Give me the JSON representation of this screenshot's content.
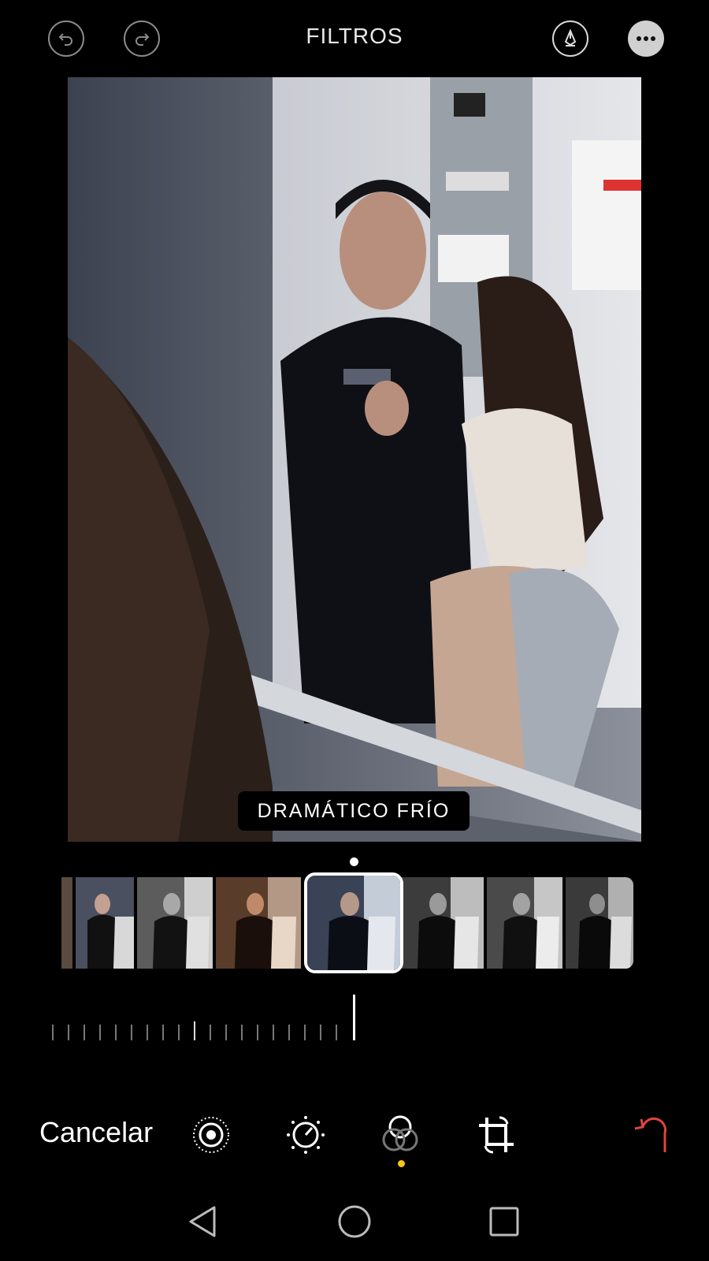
{
  "header": {
    "title": "FILTROS",
    "undo_icon": "undo-icon",
    "redo_icon": "redo-icon",
    "markup_icon": "pen-tip-icon",
    "more_icon": "ellipsis-icon"
  },
  "photo": {
    "filter_name": "DRAMÁTICO FRÍO",
    "floor_display": "2"
  },
  "filmstrip": {
    "selected_index": 4,
    "thumbnails": [
      {
        "filter": "warm"
      },
      {
        "filter": "vivid-cool"
      },
      {
        "filter": "dramatic"
      },
      {
        "filter": "dramatic-warm"
      },
      {
        "filter": "dramatic-cool"
      },
      {
        "filter": "mono"
      },
      {
        "filter": "silvertone"
      },
      {
        "filter": "noir"
      }
    ]
  },
  "toolbar": {
    "cancel_label": "Cancelar",
    "tools": [
      "live-photo-icon",
      "adjust-dial-icon",
      "filters-icon",
      "crop-rotate-icon"
    ],
    "active_tool": "filters-icon",
    "revert_icon": "revert-icon"
  },
  "system_nav": [
    "back-triangle-icon",
    "home-circle-icon",
    "recents-square-icon"
  ],
  "colors": {
    "background": "#000000",
    "accent_yellow": "#f5c518",
    "revert_red": "#e0453a"
  }
}
